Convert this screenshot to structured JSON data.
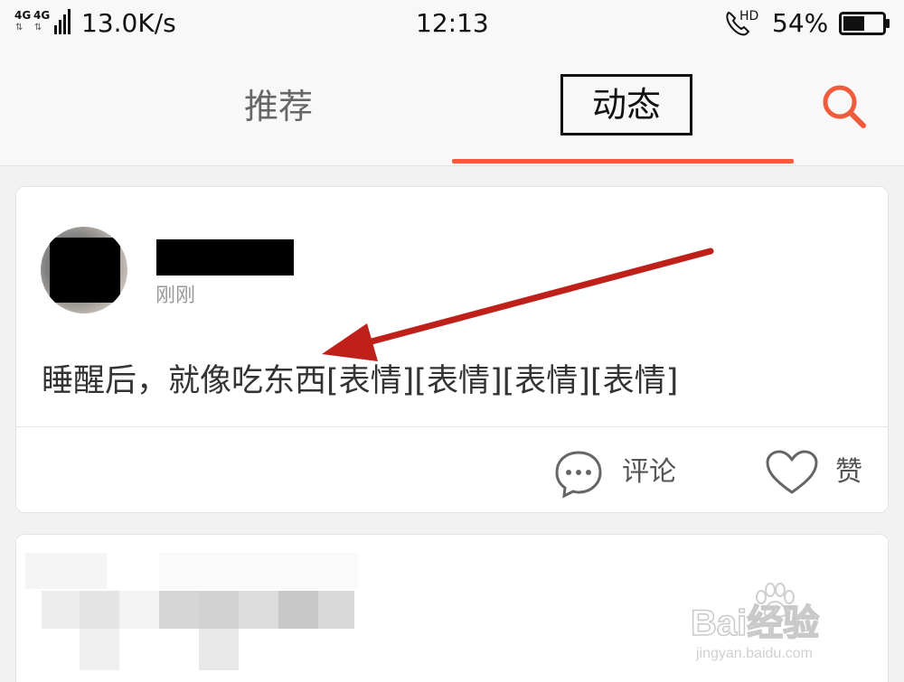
{
  "status_bar": {
    "network_left": "4G",
    "network_right": "4G",
    "net_speed": "13.0K/s",
    "time": "12:13",
    "volte": "HD",
    "battery_percent": "54%",
    "battery_level": 0.54
  },
  "tabs": [
    {
      "label": "推荐",
      "selected": false
    },
    {
      "label": "动态",
      "selected": true
    }
  ],
  "icons": {
    "search": "search-icon",
    "comment": "chat-bubble-icon",
    "like": "heart-icon",
    "call": "phone-hd-icon",
    "battery": "battery-icon"
  },
  "colors": {
    "accent": "#f15a3b",
    "annotation_arrow": "#c0201a",
    "text_primary": "#333333",
    "text_secondary": "#999999"
  },
  "post": {
    "time": "刚刚",
    "text": "睡醒后，就像吃东西[表情][表情][表情][表情]",
    "comment_label": "评论",
    "like_label": "赞"
  },
  "watermark": {
    "brand": "Bai经验",
    "url": "jingyan.baidu.com"
  }
}
